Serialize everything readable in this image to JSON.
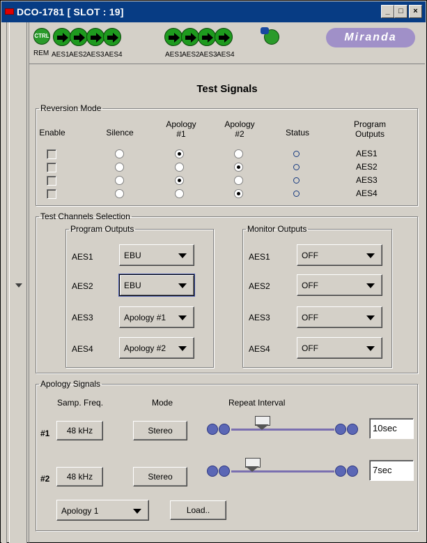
{
  "window": {
    "title": "DCO-1781 [ SLOT : 19]",
    "buttons": {
      "minimize": "_",
      "maximize": "□",
      "close": "×"
    }
  },
  "iconbar": {
    "ctrl_label": "CTRL",
    "rem_label": "REM",
    "group1_labels": [
      "AES1",
      "AES2",
      "AES3",
      "AES4"
    ],
    "group2_labels": [
      "AES1",
      "AES2",
      "AES3",
      "AES4"
    ],
    "logo": "Miranda"
  },
  "page_title": "Test Signals",
  "reversion": {
    "legend": "Reversion Mode",
    "headers": {
      "enable": "Enable",
      "silence": "Silence",
      "apology1": "Apology\n#1",
      "apology2": "Apology\n#2",
      "status": "Status",
      "outputs": "Program\nOutputs"
    },
    "rows": [
      {
        "enable": false,
        "selected": "apology1",
        "output": "AES1"
      },
      {
        "enable": false,
        "selected": "apology2",
        "output": "AES2"
      },
      {
        "enable": false,
        "selected": "apology1",
        "output": "AES3"
      },
      {
        "enable": false,
        "selected": "apology2",
        "output": "AES4"
      }
    ]
  },
  "test_channels": {
    "legend": "Test Channels Selection",
    "program": {
      "legend": "Program Outputs",
      "rows": [
        {
          "label": "AES1",
          "value": "EBU"
        },
        {
          "label": "AES2",
          "value": "EBU"
        },
        {
          "label": "AES3",
          "value": "Apology #1"
        },
        {
          "label": "AES4",
          "value": "Apology #2"
        }
      ]
    },
    "monitor": {
      "legend": "Monitor Outputs",
      "rows": [
        {
          "label": "AES1",
          "value": "OFF"
        },
        {
          "label": "AES2",
          "value": "OFF"
        },
        {
          "label": "AES3",
          "value": "OFF"
        },
        {
          "label": "AES4",
          "value": "OFF"
        }
      ]
    }
  },
  "apology_signals": {
    "legend": "Apology Signals",
    "headers": {
      "freq": "Samp. Freq.",
      "mode": "Mode",
      "interval": "Repeat Interval"
    },
    "rows": [
      {
        "label": "#1",
        "freq": "48 kHz",
        "mode": "Stereo",
        "interval": "10sec",
        "slider_fraction": 0.3
      },
      {
        "label": "#2",
        "freq": "48 kHz",
        "mode": "Stereo",
        "interval": "7sec",
        "slider_fraction": 0.2
      }
    ],
    "preset_select": "Apology 1",
    "load_button": "Load.."
  },
  "colors": {
    "titlebar": "#073c84",
    "face": "#d4d0c8",
    "accent": "#5b67b5"
  }
}
